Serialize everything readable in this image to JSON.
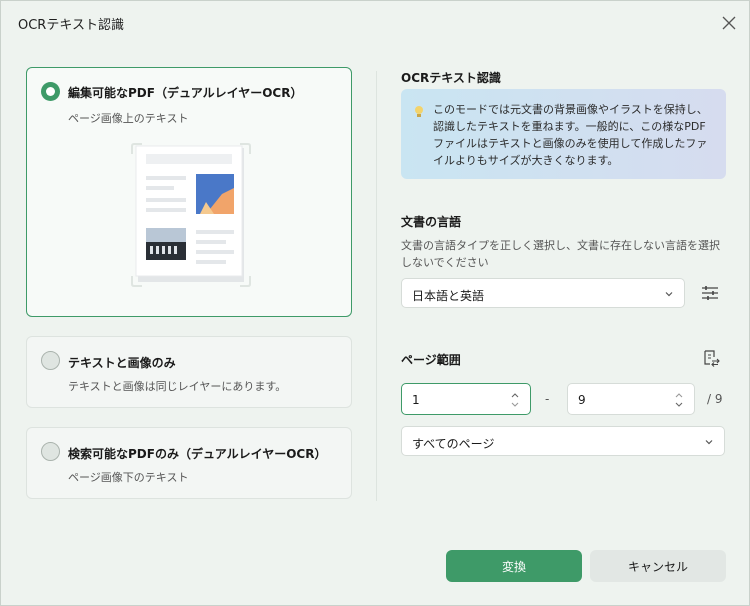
{
  "dialog": {
    "title": "OCRテキスト認識"
  },
  "options": [
    {
      "title": "編集可能なPDF（デュアルレイヤーOCR）",
      "subtitle": "ページ画像上のテキスト",
      "selected": true
    },
    {
      "title": "テキストと画像のみ",
      "subtitle": "テキストと画像は同じレイヤーにあります。",
      "selected": false
    },
    {
      "title": "検索可能なPDFのみ（デュアルレイヤーOCR）",
      "subtitle": "ページ画像下のテキスト",
      "selected": false
    }
  ],
  "ocr": {
    "heading": "OCRテキスト認識",
    "info": "このモードでは元文書の背景画像やイラストを保持し、認識したテキストを重ねます。一般的に、この様なPDFファイルはテキストと画像のみを使用して作成したファイルよりもサイズが大きくなります。"
  },
  "language": {
    "heading": "文書の言語",
    "description": "文書の言語タイプを正しく選択し、文書に存在しない言語を選択しないでください",
    "selected": "日本語と英語"
  },
  "page_range": {
    "heading": "ページ範囲",
    "from": "1",
    "dash": "-",
    "to": "9",
    "total": "/ 9",
    "selected": "すべてのページ"
  },
  "buttons": {
    "convert": "変換",
    "cancel": "キャンセル"
  },
  "colors": {
    "accent": "#3e9a68",
    "background": "#eef3ef"
  }
}
